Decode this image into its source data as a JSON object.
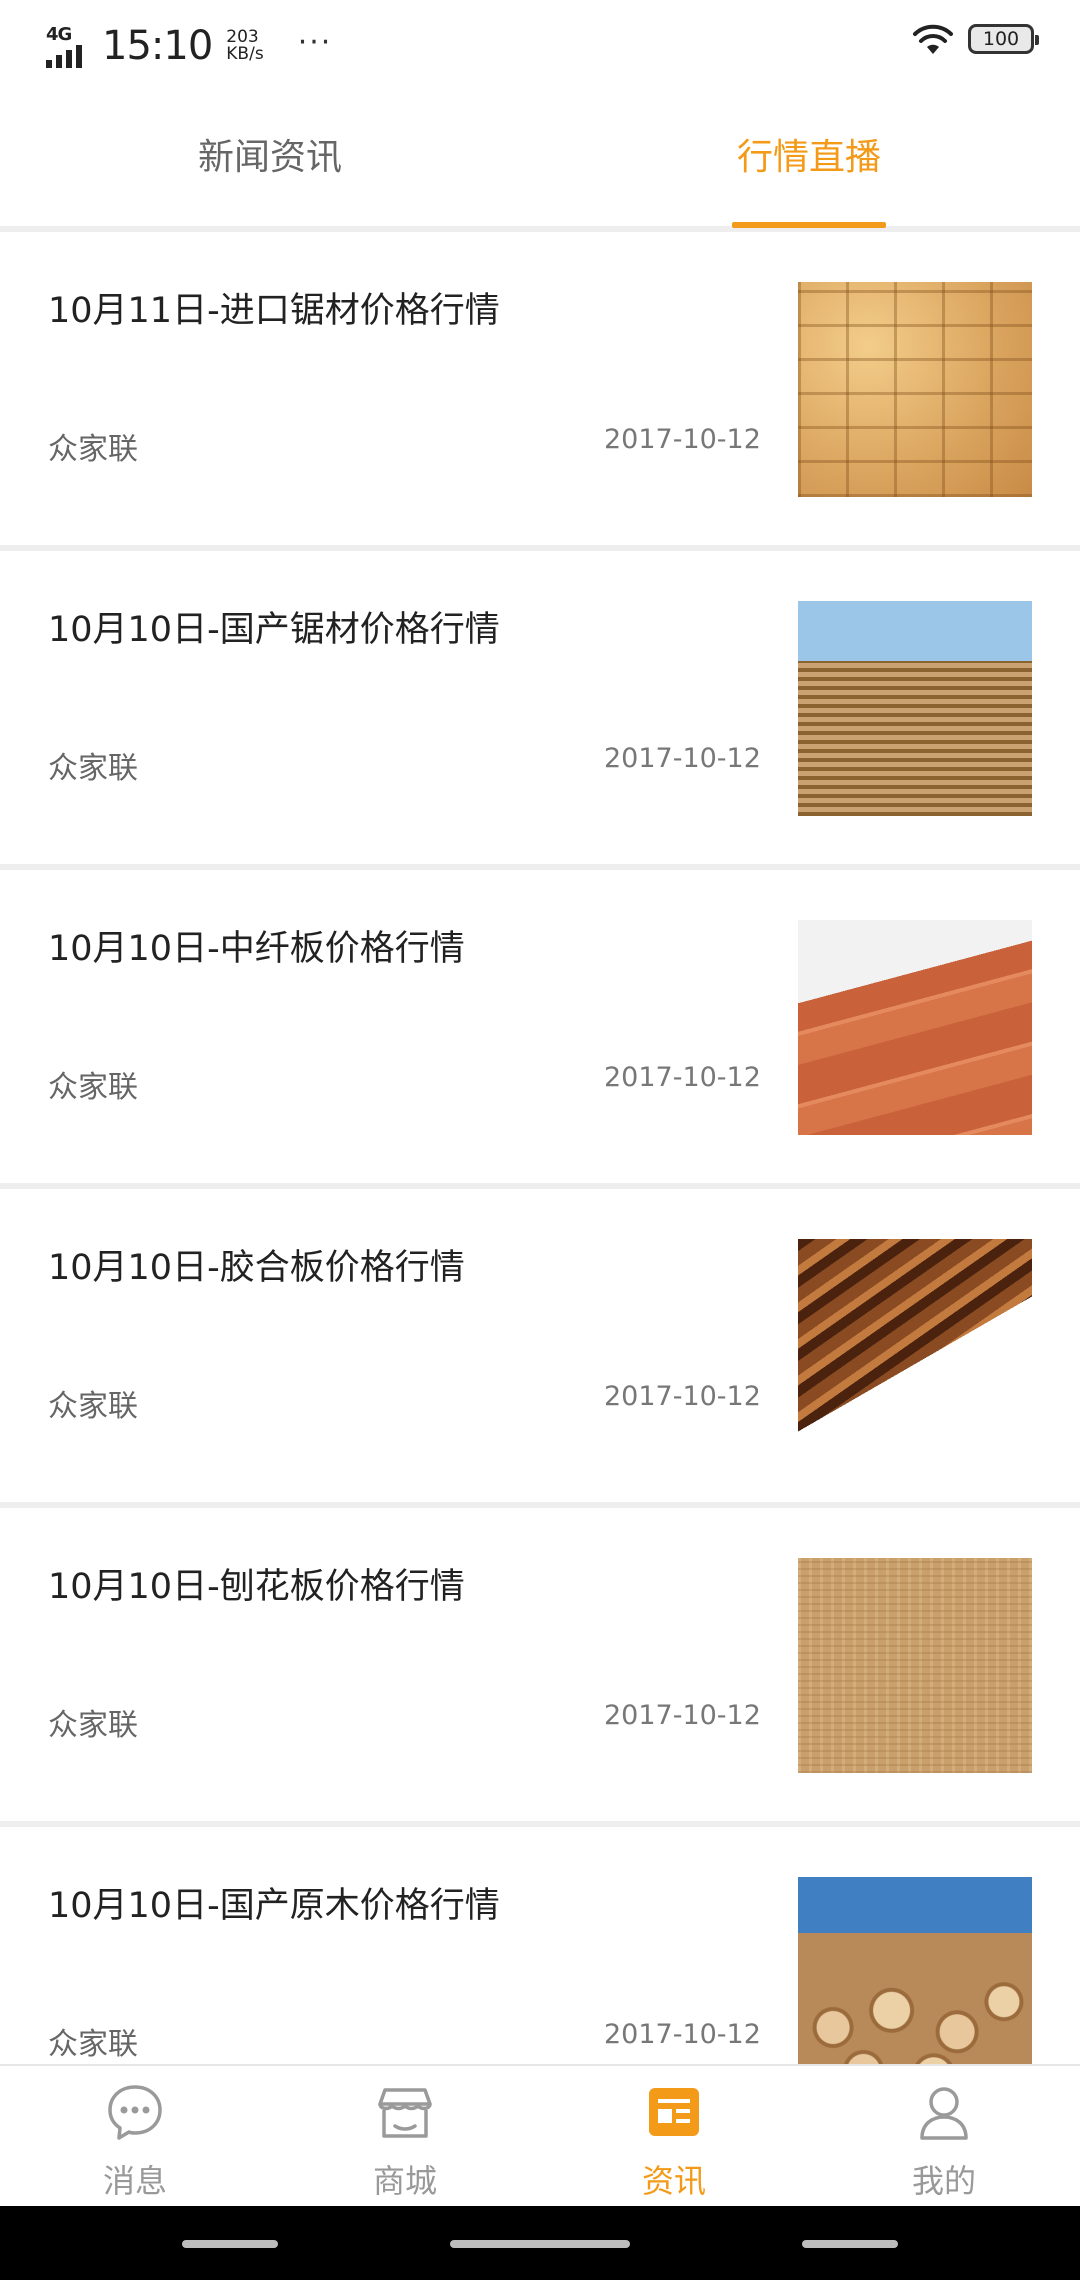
{
  "status_bar": {
    "network": "4G",
    "time": "15:10",
    "speed_value": "203",
    "speed_unit": "KB/s",
    "more": "···",
    "battery": "100"
  },
  "tabs": [
    {
      "label": "新闻资讯",
      "active": false
    },
    {
      "label": "行情直播",
      "active": true
    }
  ],
  "accent_color": "#f39a18",
  "items": [
    {
      "title": "10月11日-进口锯材价格行情",
      "source": "众家联",
      "date": "2017-10-12",
      "image": "stacked-lumber-ends"
    },
    {
      "title": "10月10日-国产锯材价格行情",
      "source": "众家联",
      "date": "2017-10-12",
      "image": "lumber-stacks-outdoor"
    },
    {
      "title": "10月10日-中纤板价格行情",
      "source": "众家联",
      "date": "2017-10-12",
      "image": "wood-planks"
    },
    {
      "title": "10月10日-胶合板价格行情",
      "source": "众家联",
      "date": "2017-10-12",
      "image": "dark-wood-boards"
    },
    {
      "title": "10月10日-刨花板价格行情",
      "source": "众家联",
      "date": "2017-10-12",
      "image": "particle-board-texture"
    },
    {
      "title": "10月10日-国产原木价格行情",
      "source": "众家联",
      "date": "2017-10-12",
      "image": "log-pile"
    }
  ],
  "bottom_nav": [
    {
      "label": "消息",
      "icon": "chat-bubble-icon",
      "active": false
    },
    {
      "label": "商城",
      "icon": "store-icon",
      "active": false
    },
    {
      "label": "资讯",
      "icon": "news-icon",
      "active": true
    },
    {
      "label": "我的",
      "icon": "user-icon",
      "active": false
    }
  ]
}
